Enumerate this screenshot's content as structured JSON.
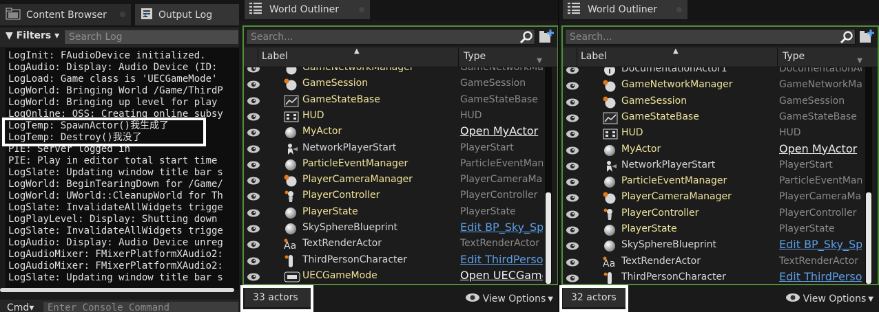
{
  "left": {
    "tabs": {
      "content_browser": "Content Browser",
      "output_log": "Output Log"
    },
    "filters_label": "Filters",
    "search_placeholder": "Search Log",
    "log_lines": [
      "LogInit: FAudioDevice initialized.",
      "LogAudio: Display: Audio Device (ID: ",
      "LogLoad: Game class is 'UECGameMode'",
      "LogWorld: Bringing World /Game/ThirdP",
      "LogWorld: Bringing up level for play",
      "LogOnline: OSS: Creating online subsy",
      "LogTemp: SpawnActor()我生成了",
      "LogTemp: Destroy()我没了",
      "PIE: Server logged in",
      "PIE: Play in editor total start time",
      "LogSlate: Updating window title bar s",
      "LogWorld: BeginTearingDown for /Game/",
      "LogWorld: UWorld::CleanupWorld for Th",
      "LogSlate: InvalidateAllWidgets trigge",
      "LogPlayLevel: Display: Shutting down ",
      "LogSlate: InvalidateAllWidgets trigge",
      "LogAudio: Display: Audio Device unreg",
      "LogAudioMixer: FMixerPlatformXAudio2:",
      "LogAudioMixer: FMixerPlatformXAudio2:",
      "LogSlate: Updating window title bar s"
    ],
    "cmd_label": "Cmd",
    "console_placeholder": "Enter Console Command"
  },
  "outliner_left": {
    "tab_title": "World Outliner",
    "search_placeholder": "Search...",
    "col_label": "Label",
    "col_type": "Type",
    "rows": [
      {
        "label": "GameNetworkManager",
        "type": "GameNetworkManager",
        "yellow": true,
        "icon": "sphere-gear-icon",
        "kind": "plain"
      },
      {
        "label": "GameSession",
        "type": "GameSession",
        "yellow": true,
        "icon": "sphere-gear-icon",
        "kind": "plain"
      },
      {
        "label": "GameStateBase",
        "type": "GameStateBase",
        "yellow": true,
        "icon": "chart-icon",
        "kind": "plain"
      },
      {
        "label": "HUD",
        "type": "HUD",
        "yellow": true,
        "icon": "hud-icon",
        "kind": "plain"
      },
      {
        "label": "MyActor",
        "type": "Open MyActor",
        "yellow": true,
        "icon": "sphere-icon",
        "kind": "open"
      },
      {
        "label": "NetworkPlayerStart",
        "type": "PlayerStart",
        "yellow": false,
        "icon": "player-start-icon",
        "kind": "plain"
      },
      {
        "label": "ParticleEventManager",
        "type": "ParticleEventMan",
        "yellow": true,
        "icon": "sphere-icon",
        "kind": "plain"
      },
      {
        "label": "PlayerCameraManager",
        "type": "PlayerCameraMan",
        "yellow": true,
        "icon": "sphere-gear-icon",
        "kind": "plain"
      },
      {
        "label": "PlayerController",
        "type": "PlayerController",
        "yellow": true,
        "icon": "controller-icon",
        "kind": "plain"
      },
      {
        "label": "PlayerState",
        "type": "PlayerState",
        "yellow": true,
        "icon": "sphere-icon",
        "kind": "plain"
      },
      {
        "label": "SkySphereBlueprint",
        "type": "Edit BP_Sky_Sp",
        "yellow": false,
        "icon": "sphere-icon",
        "kind": "edit"
      },
      {
        "label": "TextRenderActor",
        "type": "TextRenderActor",
        "yellow": false,
        "icon": "text-aa-icon",
        "kind": "plain"
      },
      {
        "label": "ThirdPersonCharacter",
        "type": "Edit ThirdPerso",
        "yellow": false,
        "icon": "character-icon",
        "kind": "edit"
      },
      {
        "label": "UECGameMode",
        "type": "Open UECGame",
        "yellow": true,
        "icon": "gamemode-icon",
        "kind": "open"
      }
    ],
    "scroll_fraction": 0.42,
    "count": "33 actors",
    "view_options": "View Options"
  },
  "outliner_right": {
    "tab_title": "World Outliner",
    "search_placeholder": "Search...",
    "col_label": "Label",
    "col_type": "Type",
    "rows": [
      {
        "label": "DocumentationActor1",
        "type": "DocumentationAc",
        "yellow": false,
        "icon": "info-icon",
        "kind": "plain"
      },
      {
        "label": "GameNetworkManager",
        "type": "GameNetworkMa",
        "yellow": true,
        "icon": "sphere-gear-icon",
        "kind": "plain"
      },
      {
        "label": "GameSession",
        "type": "GameSession",
        "yellow": true,
        "icon": "sphere-gear-icon",
        "kind": "plain"
      },
      {
        "label": "GameStateBase",
        "type": "GameStateBase",
        "yellow": true,
        "icon": "chart-icon",
        "kind": "plain"
      },
      {
        "label": "HUD",
        "type": "HUD",
        "yellow": true,
        "icon": "hud-icon",
        "kind": "plain"
      },
      {
        "label": "MyActor",
        "type": "Open MyActor",
        "yellow": true,
        "icon": "sphere-icon",
        "kind": "open"
      },
      {
        "label": "NetworkPlayerStart",
        "type": "PlayerStart",
        "yellow": false,
        "icon": "player-start-icon",
        "kind": "plain"
      },
      {
        "label": "ParticleEventManager",
        "type": "ParticleEventMan",
        "yellow": true,
        "icon": "sphere-icon",
        "kind": "plain"
      },
      {
        "label": "PlayerCameraManager",
        "type": "PlayerCameraMan",
        "yellow": true,
        "icon": "sphere-gear-icon",
        "kind": "plain"
      },
      {
        "label": "PlayerController",
        "type": "PlayerController",
        "yellow": true,
        "icon": "controller-icon",
        "kind": "plain"
      },
      {
        "label": "PlayerState",
        "type": "PlayerState",
        "yellow": true,
        "icon": "sphere-icon",
        "kind": "plain"
      },
      {
        "label": "SkySphereBlueprint",
        "type": "Edit BP_Sky_Sp",
        "yellow": false,
        "icon": "sphere-icon",
        "kind": "edit"
      },
      {
        "label": "TextRenderActor",
        "type": "TextRenderActor",
        "yellow": false,
        "icon": "text-aa-icon",
        "kind": "plain"
      },
      {
        "label": "ThirdPersonCharacter",
        "type": "Edit ThirdPerso",
        "yellow": false,
        "icon": "character-icon",
        "kind": "edit"
      }
    ],
    "scroll_fraction": 0.42,
    "count": "32 actors",
    "view_options": "View Options"
  },
  "colors": {
    "accent_green": "#4f8f3a",
    "label_yellow": "#efe29a",
    "link_blue": "#5a9ee6",
    "highlight_white": "#ffffff"
  }
}
